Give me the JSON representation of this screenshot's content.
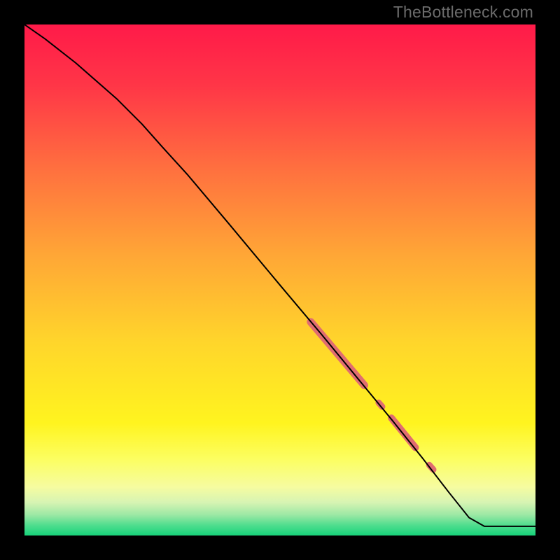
{
  "watermark": "TheBottleneck.com",
  "chart_data": {
    "type": "line",
    "title": "",
    "xlabel": "",
    "ylabel": "",
    "xlim": [
      0,
      100
    ],
    "ylim": [
      0,
      100
    ],
    "grid": false,
    "axes_visible": false,
    "background_gradient": {
      "direction": "vertical",
      "stops": [
        {
          "pos": 0.0,
          "color": "#ff1a49"
        },
        {
          "pos": 0.12,
          "color": "#ff3647"
        },
        {
          "pos": 0.28,
          "color": "#ff6f3f"
        },
        {
          "pos": 0.45,
          "color": "#ffa636"
        },
        {
          "pos": 0.62,
          "color": "#ffd52b"
        },
        {
          "pos": 0.78,
          "color": "#fff41f"
        },
        {
          "pos": 0.85,
          "color": "#fcfe60"
        },
        {
          "pos": 0.905,
          "color": "#f6fca0"
        },
        {
          "pos": 0.935,
          "color": "#d7f4b3"
        },
        {
          "pos": 0.96,
          "color": "#9be8a4"
        },
        {
          "pos": 0.98,
          "color": "#4fdd8e"
        },
        {
          "pos": 1.0,
          "color": "#17d37a"
        }
      ]
    },
    "series": [
      {
        "name": "curve",
        "color": "#000000",
        "stroke_width": 2,
        "x": [
          0.0,
          4.0,
          10.0,
          18.0,
          23.0,
          27.0,
          32.0,
          40.0,
          50.0,
          58.0,
          65.0,
          72.0,
          78.0,
          83.0,
          87.0,
          90.0,
          100.0
        ],
        "y": [
          100.0,
          97.2,
          92.5,
          85.5,
          80.5,
          76.0,
          70.5,
          61.0,
          49.0,
          39.5,
          31.0,
          22.5,
          15.0,
          8.5,
          3.5,
          1.8,
          1.8
        ]
      }
    ],
    "highlights": [
      {
        "name": "band-1",
        "color": "#e06d70",
        "stroke_width": 11,
        "x": [
          56.0,
          66.5
        ],
        "y": [
          41.8,
          29.4
        ]
      },
      {
        "name": "dot-1",
        "color": "#e06d70",
        "stroke_width": 9,
        "x": [
          69.3,
          70.0
        ],
        "y": [
          26.0,
          25.2
        ]
      },
      {
        "name": "band-2",
        "color": "#e06d70",
        "stroke_width": 10,
        "x": [
          71.8,
          76.5
        ],
        "y": [
          23.0,
          17.2
        ]
      },
      {
        "name": "dot-2",
        "color": "#e06d70",
        "stroke_width": 9,
        "x": [
          79.2,
          80.0
        ],
        "y": [
          13.8,
          12.9
        ]
      }
    ]
  }
}
